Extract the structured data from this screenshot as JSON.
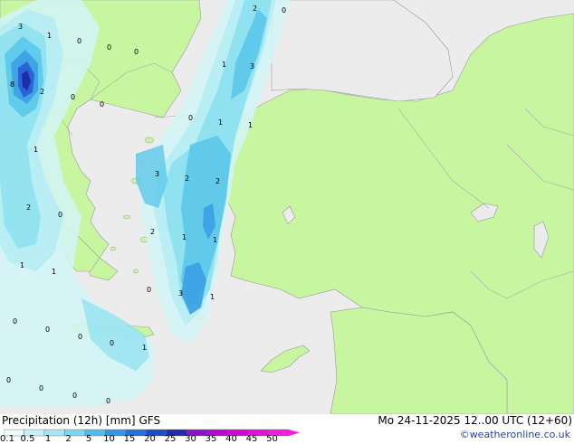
{
  "title": "Precipitation (12h) [mm]",
  "model": "GFS",
  "valid_time": "Mo 24-11-2025 12..00 UTC (12+60)",
  "credit": "©weatheronline.co.uk",
  "colors": {
    "sea": "#ececec",
    "land": "#c8f5a0",
    "border": "#999999",
    "p01": "#d2f4f8",
    "p05": "#b4ecf4",
    "p1": "#8ce0f0",
    "p2": "#5cc8ea",
    "p5": "#3ca0e6",
    "p10": "#2864d8",
    "p20": "#1e2ca8"
  },
  "scale": {
    "labels": [
      "0.1",
      "0.5",
      "1",
      "2",
      "5",
      "10",
      "15",
      "20",
      "25",
      "30",
      "35",
      "40",
      "45",
      "50"
    ],
    "colors": [
      "#e8fafc",
      "#c8f0f8",
      "#a6e6f4",
      "#7ad6f0",
      "#50bcec",
      "#3296e4",
      "#2470d8",
      "#1e4cc8",
      "#1e2ca8",
      "#8c14c8",
      "#b40ad2",
      "#cc0ad2",
      "#e014d8",
      "#f01edc"
    ]
  },
  "labels": [
    {
      "v": "3"
    },
    {
      "v": "1"
    },
    {
      "v": "0"
    },
    {
      "v": "0"
    },
    {
      "v": "0"
    },
    {
      "v": "8"
    },
    {
      "v": "2"
    },
    {
      "v": "0"
    },
    {
      "v": "2"
    },
    {
      "v": "0"
    },
    {
      "v": "1"
    },
    {
      "v": "3"
    },
    {
      "v": "0"
    },
    {
      "v": "1"
    },
    {
      "v": "1"
    },
    {
      "v": "1"
    },
    {
      "v": "3"
    },
    {
      "v": "2"
    },
    {
      "v": "2"
    },
    {
      "v": "2"
    },
    {
      "v": "0"
    },
    {
      "v": "2"
    },
    {
      "v": "1"
    },
    {
      "v": "1"
    },
    {
      "v": "1"
    },
    {
      "v": "1"
    },
    {
      "v": "0"
    },
    {
      "v": "3"
    },
    {
      "v": "1"
    },
    {
      "v": "0"
    },
    {
      "v": "0"
    },
    {
      "v": "0"
    },
    {
      "v": "0"
    },
    {
      "v": "1"
    },
    {
      "v": "0"
    },
    {
      "v": "0"
    },
    {
      "v": "0"
    },
    {
      "v": "0"
    },
    {
      "v": "0"
    }
  ]
}
